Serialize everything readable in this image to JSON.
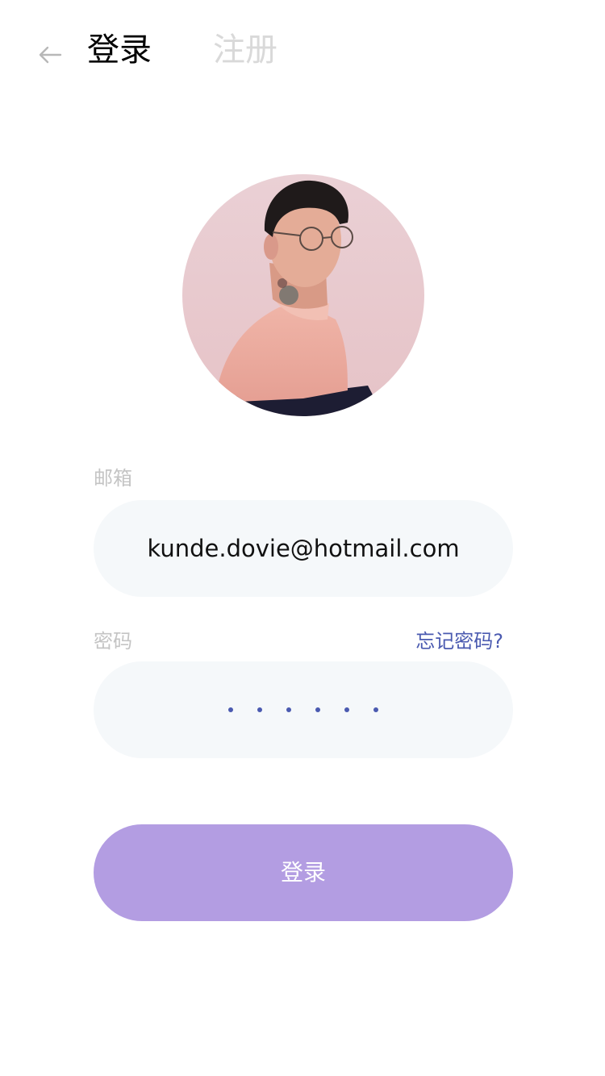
{
  "header": {
    "back_icon": "arrow-left-icon",
    "tabs": [
      {
        "label": "登录",
        "active": true
      },
      {
        "label": "注册",
        "active": false
      }
    ]
  },
  "avatar": {
    "description": "profile-photo"
  },
  "form": {
    "email_label": "邮箱",
    "email_value": "kunde.dovie@hotmail.com",
    "password_label": "密码",
    "forgot_label": "忘记密码?",
    "password_length": 6
  },
  "submit": {
    "label": "登录"
  },
  "colors": {
    "accent": "#b39de2",
    "link": "#4a5ab0",
    "input_bg": "#f5f8fa",
    "label": "#c4c4c4",
    "inactive_tab": "#d9d9d9"
  }
}
